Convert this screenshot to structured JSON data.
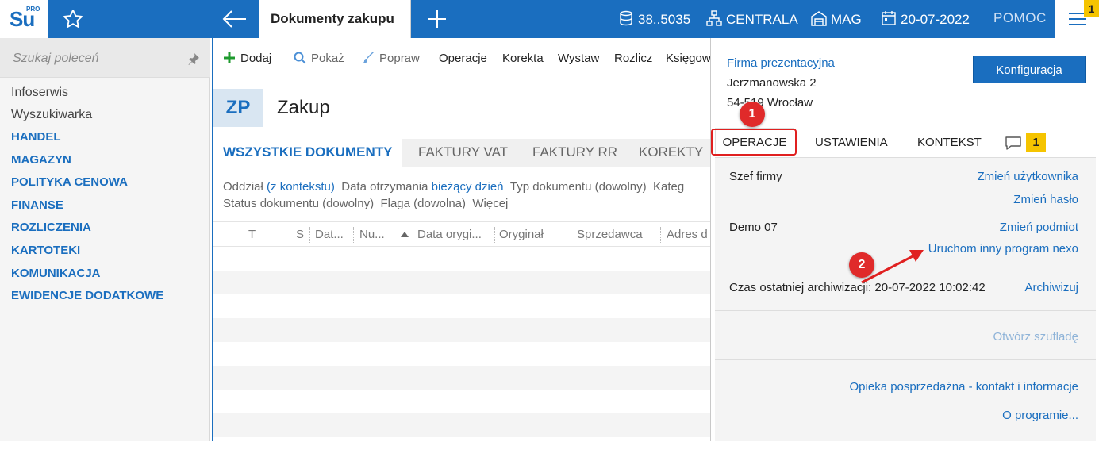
{
  "topbar": {
    "logo_text": "Su",
    "logo_sup": "PRO",
    "active_tab": "Dokumenty zakupu",
    "server": "38..5035",
    "branch": "CENTRALA",
    "warehouse": "MAG",
    "date": "20-07-2022",
    "help": "POMOC",
    "menu_badge": "1",
    "accent": "#1a6ebf"
  },
  "sidebar": {
    "search_placeholder": "Szukaj poleceń",
    "items": [
      {
        "label": "Infoserwis",
        "style": "plain"
      },
      {
        "label": "Wyszukiwarka",
        "style": "plain"
      },
      {
        "label": "HANDEL",
        "style": "bold"
      },
      {
        "label": "MAGAZYN",
        "style": "bold"
      },
      {
        "label": "POLITYKA CENOWA",
        "style": "bold"
      },
      {
        "label": "FINANSE",
        "style": "bold"
      },
      {
        "label": "ROZLICZENIA",
        "style": "bold"
      },
      {
        "label": "KARTOTEKI",
        "style": "bold"
      },
      {
        "label": "KOMUNIKACJA",
        "style": "bold"
      },
      {
        "label": "EWIDENCJE DODATKOWE",
        "style": "bold"
      }
    ]
  },
  "toolbar": {
    "add": "Dodaj",
    "show": "Pokaż",
    "fix": "Popraw",
    "operations": "Operacje",
    "correction": "Korekta",
    "issue": "Wystaw",
    "settle": "Rozlicz",
    "book": "Księgow"
  },
  "doc": {
    "code": "ZP",
    "title": "Zakup",
    "tabs": [
      "WSZYSTKIE DOKUMENTY",
      "FAKTURY VAT",
      "FAKTURY RR",
      "KOREKTY"
    ],
    "filters": {
      "branch_label": "Oddział",
      "branch_value": "(z kontekstu)",
      "date_label": "Data otrzymania",
      "date_value": "bieżący dzień",
      "type": "Typ dokumentu (dowolny)",
      "category": "Kateg",
      "status": "Status dokumentu (dowolny)",
      "flag": "Flaga (dowolna)",
      "more": "Więcej"
    },
    "columns": [
      "T",
      "S",
      "Dat...",
      "Nu...",
      "Data orygi...",
      "Oryginał",
      "Sprzedawca",
      "Adres d"
    ]
  },
  "panel": {
    "firm_name": "Firma prezentacyjna",
    "street": "Jerzmanowska 2",
    "city": "54-519 Wrocław",
    "config_button": "Konfiguracja",
    "tabs": [
      "OPERACJE",
      "USTAWIENIA",
      "KONTEKST"
    ],
    "messages_badge": "1",
    "user": "Szef firmy",
    "change_user": "Zmień użytkownika",
    "change_password": "Zmień hasło",
    "entity": "Demo 07",
    "change_entity": "Zmień podmiot",
    "run_other": "Uruchom inny program nexo",
    "archive_label": "Czas ostatniej archiwizacji: 20-07-2022 10:02:42",
    "archive_link": "Archiwizuj",
    "open_drawer": "Otwórz szufladę",
    "support": "Opieka posprzedażna - kontakt i informacje",
    "about": "O programie..."
  },
  "annotations": {
    "callout_1": "1",
    "callout_2": "2",
    "highlight_color": "#e02020"
  }
}
